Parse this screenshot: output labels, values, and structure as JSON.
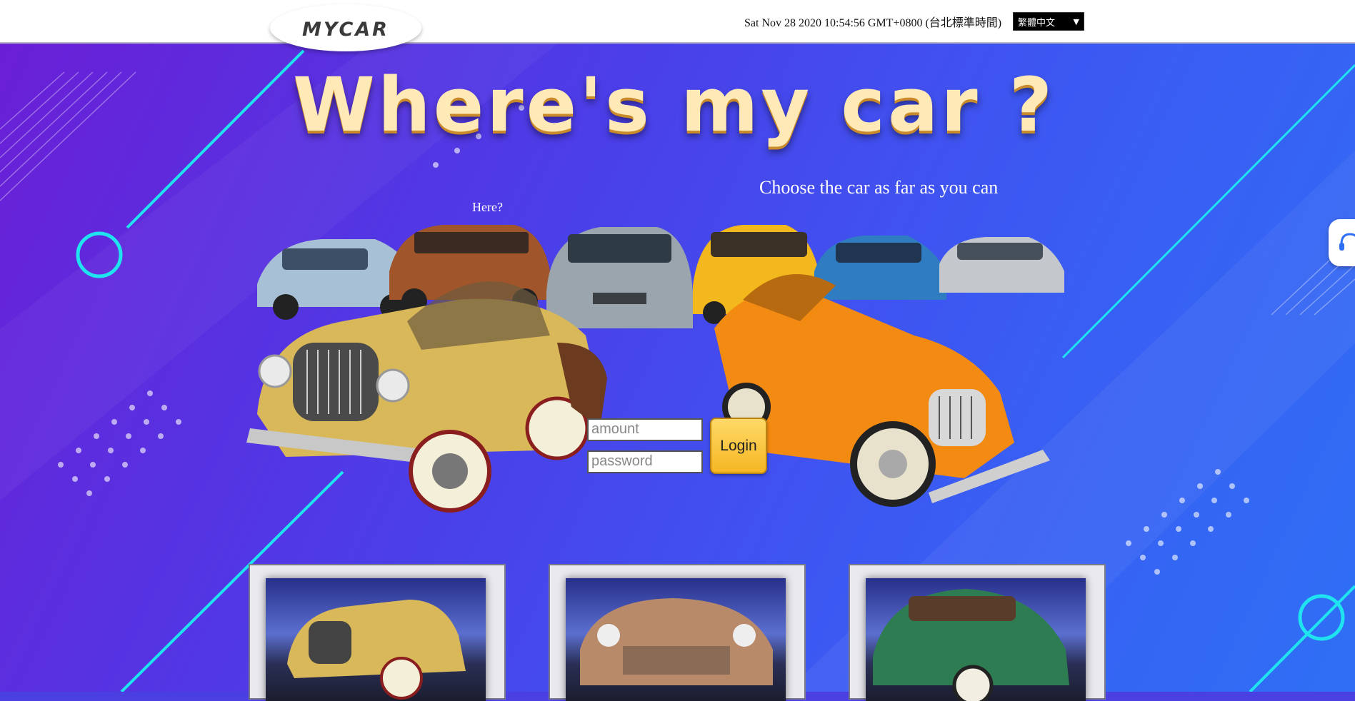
{
  "header": {
    "logo_text": "MYCAR",
    "datetime": "Sat Nov 28 2020 10:54:56 GMT+0800 (台北標準時間)",
    "language": "繁體中文"
  },
  "hero": {
    "headline": "Where's my car ?",
    "subtitle": "Choose the car as far as you can",
    "hint": "Here?"
  },
  "login": {
    "amount_placeholder": "amount",
    "password_placeholder": "password",
    "button_label": "Login"
  },
  "colors": {
    "accent_cyan": "#1fe4f0",
    "login_button": "#f5b623",
    "headline": "#ffe9b6"
  },
  "support_widget": {
    "icon": "headset-icon"
  },
  "thumbnails": [
    {
      "name": "vintage-yellow-convertible"
    },
    {
      "name": "classic-bronze-sedan"
    },
    {
      "name": "classic-green-sedan"
    }
  ]
}
